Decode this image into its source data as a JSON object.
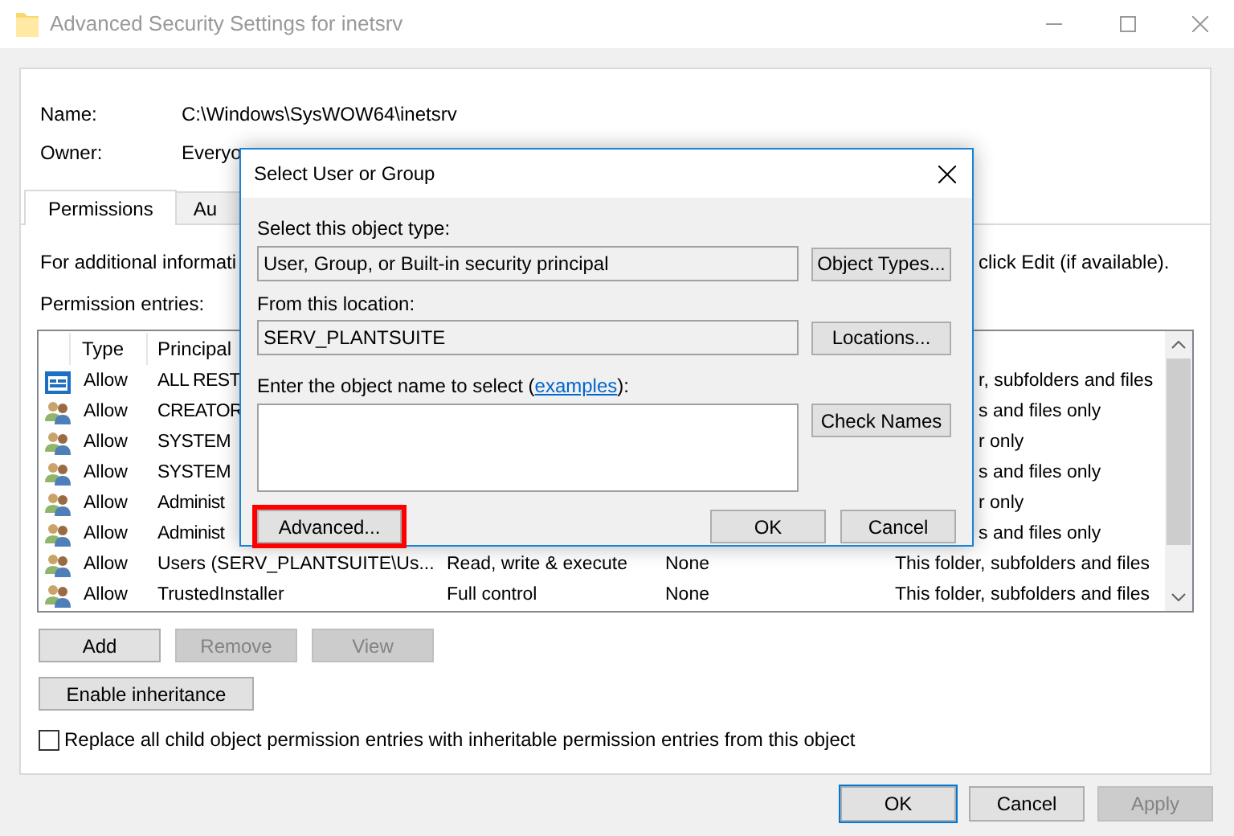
{
  "window": {
    "title": "Advanced Security Settings for inetsrv"
  },
  "name": {
    "label": "Name:",
    "value": "C:\\Windows\\SysWOW64\\inetsrv"
  },
  "owner": {
    "label": "Owner:",
    "value": "Everyo"
  },
  "tabs": [
    {
      "label": "Permissions",
      "selected": true
    },
    {
      "label": "Au",
      "selected": false
    }
  ],
  "info_text": [
    "For additional informati",
    "click Edit (if available)."
  ],
  "entries_label": "Permission entries:",
  "table": {
    "columns": [
      "Type",
      "Principal"
    ],
    "rows": [
      {
        "kind": "package",
        "type": "Allow",
        "principal": "ALL REST",
        "applies_to": "r, subfolders and files"
      },
      {
        "kind": "users",
        "type": "Allow",
        "principal": "CREATOR",
        "applies_to": "s and files only"
      },
      {
        "kind": "users",
        "type": "Allow",
        "principal": "SYSTEM",
        "applies_to": "r only"
      },
      {
        "kind": "users",
        "type": "Allow",
        "principal": "SYSTEM",
        "applies_to": "s and files only"
      },
      {
        "kind": "users",
        "type": "Allow",
        "principal": "Administ",
        "applies_to": "r only"
      },
      {
        "kind": "users",
        "type": "Allow",
        "principal": "Administ",
        "applies_to": "s and files only"
      },
      {
        "kind": "users",
        "type": "Allow",
        "principal": "Users (SERV_PLANTSUITE\\Us...",
        "access": "Read, write & execute",
        "inherited": "None",
        "applies_to": "This folder, subfolders and files"
      },
      {
        "kind": "users",
        "type": "Allow",
        "principal": "TrustedInstaller",
        "access": "Full control",
        "inherited": "None",
        "applies_to": "This folder, subfolders and files"
      }
    ]
  },
  "list_buttons": [
    {
      "label": "Add",
      "disabled": false
    },
    {
      "label": "Remove",
      "disabled": true
    },
    {
      "label": "View",
      "disabled": true
    }
  ],
  "inheritance_button": "Enable inheritance",
  "replace_checkbox": {
    "label": "Replace all child object permission entries with inheritable permission entries from this object",
    "checked": false
  },
  "footer_buttons": [
    {
      "label": "OK",
      "disabled": false,
      "default": true
    },
    {
      "label": "Cancel",
      "disabled": false,
      "default": false
    },
    {
      "label": "Apply",
      "disabled": true,
      "default": false
    }
  ],
  "dialog": {
    "title": "Select User or Group",
    "object_type": {
      "label": "Select this object type:",
      "value": "User, Group, or Built-in security principal",
      "button": "Object Types..."
    },
    "location": {
      "label": "From this location:",
      "value": "SERV_PLANTSUITE",
      "button": "Locations..."
    },
    "object_name": {
      "label_before": "Enter the object name to select (",
      "link": "examples",
      "label_after": "):",
      "button": "Check Names"
    },
    "buttons": [
      {
        "label": "Advanced...",
        "highlighted": true
      },
      {
        "label": "OK",
        "highlighted": false
      },
      {
        "label": "Cancel",
        "highlighted": false
      }
    ]
  }
}
